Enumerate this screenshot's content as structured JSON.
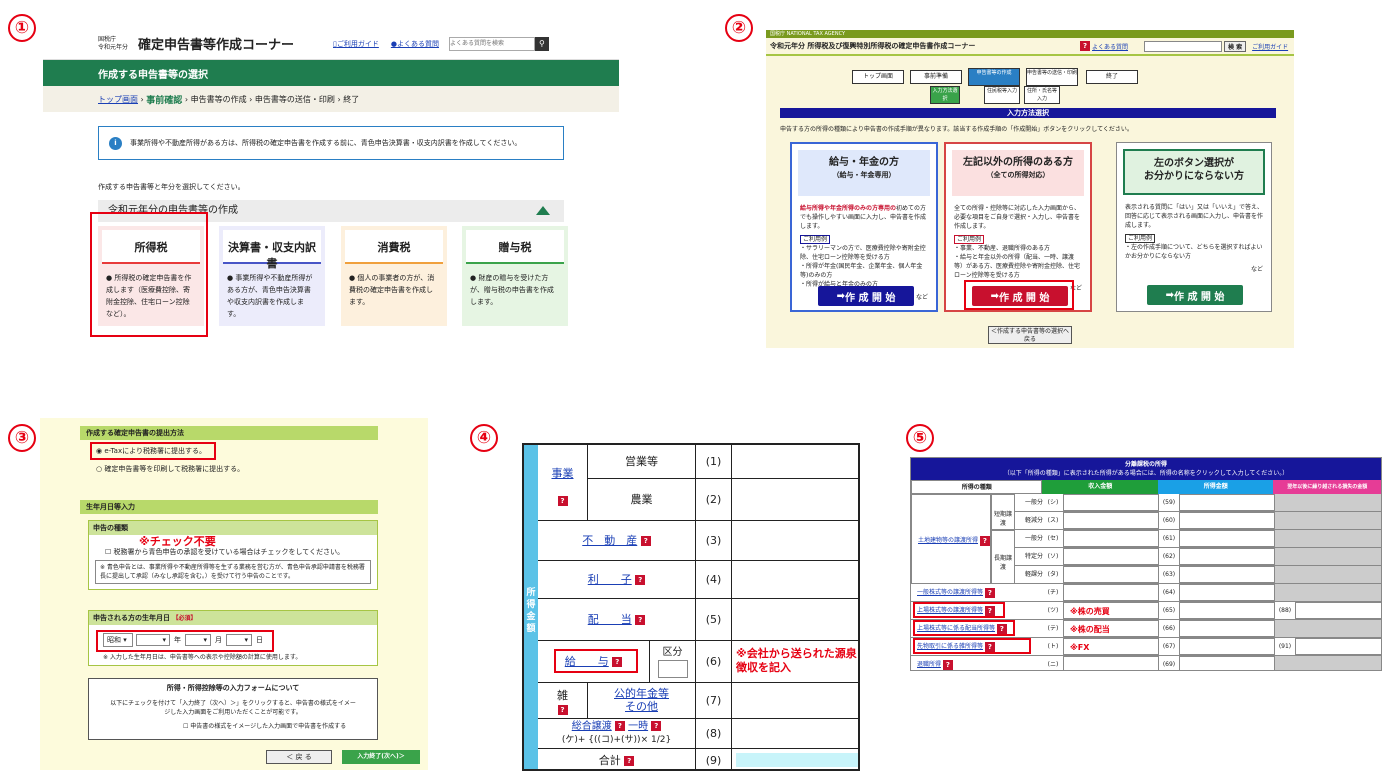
{
  "markers": [
    "①",
    "②",
    "③",
    "④",
    "⑤"
  ],
  "p1": {
    "agency": "国税庁",
    "year": "令和元年分",
    "title": "確定申告書等作成コーナー",
    "guide": "ご利用ガイド",
    "faq": "よくある質問",
    "search_placeholder": "よくある質問を検索",
    "banner": "作成する申告書等の選択",
    "crumbs": [
      "トップ画面",
      "事前確認",
      "申告書等の作成",
      "申告書等の送信・印刷",
      "終了"
    ],
    "info": "事業所得や不動産所得がある方は、所得税の確定申告書を作成する前に、青色申告決算書・収支内訳書を作成してください。",
    "instruction": "作成する申告書等と年分を選択してください。",
    "section": "令和元年分の申告書等の作成",
    "cards": [
      {
        "title": "所得税",
        "desc": "● 所得税の確定申告書を作成します（医療費控除、寄附金控除、住宅ローン控除など）。",
        "color": "#e83a3a",
        "bg": "#fbe7e7"
      },
      {
        "title": "決算書・収支内訳書",
        "desc": "● 事業所得や不動産所得がある方が、青色申告決算書や収支内訳書を作成します。",
        "color": "#4855c7",
        "bg": "#ececfb"
      },
      {
        "title": "消費税",
        "desc": "● 個人の事業者の方が、消費税の確定申告書を作成します。",
        "color": "#f0a03c",
        "bg": "#fdf0dd"
      },
      {
        "title": "贈与税",
        "desc": "● 財産の贈与を受けた方が、贈与税の申告書を作成します。",
        "color": "#3aa34a",
        "bg": "#e6f5e3"
      }
    ]
  },
  "p2": {
    "agency": "国税庁 NATIONAL TAX AGENCY",
    "title": "令和元年分 所得税及び復興特別所得税の確定申告書作成コーナー",
    "faq": "よくある質問",
    "search_btn": "検 索",
    "guide": "ご利用ガイド",
    "steps": [
      "トップ画面",
      "事前準備",
      "申告書等の作成",
      "申告書等の送信・印刷",
      "終了"
    ],
    "substeps": [
      "入力方法選択",
      "住民税等入力",
      "住所・氏名等入力"
    ],
    "section": "入力方法選択",
    "instruction": "申告する方の所得の種類により申告書の作成手順が異なります。該当する作成手順の「作成開始」ボタンをクリックしてください。",
    "boxes": [
      {
        "head": "給与・年金の方",
        "sub": "（給与・年金専用）",
        "lead": "給与所得や年金所得のみの方専用の",
        "body": "初めての方でも操作しやすい画面に入力し、申告書を作成します。",
        "usage": "ご利用例",
        "examples": "・サラリーマンの方で、医療費控除や寄附金控除、住宅ローン控除等を受ける方\n・所得が年金(国民年金、企業年金、個人年金等)のみの方\n・所得が給与と年金のみの方",
        "etc": "など",
        "btn": "作 成 開 始"
      },
      {
        "head": "左記以外の所得のある方",
        "sub": "（全ての所得対応）",
        "lead": "",
        "body": "全ての所得・控除等に対応した入力画面から、必要な項目をご自身で選択・入力し、申告書を作成します。",
        "usage": "ご利用例",
        "examples": "・事業、不動産、退職所得のある方\n・給与と年金以外の所得（配当、一時、譲渡等）がある方、医療費控除や寄附金控除、住宅ローン控除等を受ける方",
        "etc": "など",
        "btn": "作 成 開 始"
      },
      {
        "head": "左のボタン選択が",
        "sub": "お分かりにならない方",
        "lead": "",
        "body": "表示される質問に「はい」又は「いいえ」で答え、回答に応じて表示される画面に入力し、申告書を作成します。",
        "usage": "ご利用例",
        "examples": "・左の作成手順について、どちらを選択すればよいかお分かりにならない方",
        "etc": "など",
        "btn": "作 成 開 始"
      }
    ],
    "back": "＜作成する申告書等の選択へ戻る"
  },
  "p3": {
    "method_title": "作成する確定申告書の提出方法",
    "opt1": "e-Taxにより税務署に提出する。",
    "opt2": "確定申告書等を印刷して税務署に提出する。",
    "birth_section": "生年月日等入力",
    "kind_title": "申告の種類",
    "no_check": "※チェック不要",
    "kind_check": "税務署から青色申告の承認を受けている場合はチェックをしてください。",
    "note": "※ 青色申告とは、事業所得や不動産所得等を生ずる業務を営む方が、青色申告承認申請書を税務署長に提出して承認（みなし承認を含む。）を受けて行う申告のことです。",
    "birth_title": "申告される方の生年月日",
    "required": "必須",
    "era": "昭和",
    "y": "年",
    "m": "月",
    "d": "日",
    "birth_note": "※ 入力した生年月日は、申告書等への表示や控除額の計算に使用します。",
    "form_title": "所得・所得控除等の入力フォームについて",
    "form_text": "以下にチェックを付けて「入力終了（次へ）＞」をクリックすると、申告書の様式をイメージした入力画面をご利用いただくことが可能です。",
    "form_check": "申告書の様式をイメージした入力画面で申告書を作成する",
    "back": "＜ 戻 る",
    "next": "入力終了(次へ)＞"
  },
  "p4": {
    "side": "所得金額",
    "rows": [
      {
        "label": "事業",
        "sub": "営業等",
        "n": "(1)"
      },
      {
        "label": "",
        "sub": "農業",
        "n": "(2)"
      },
      {
        "label": "不　動　産",
        "n": "(3)"
      },
      {
        "label": "利　　子",
        "n": "(4)"
      },
      {
        "label": "配　　当",
        "n": "(5)"
      },
      {
        "label": "給　　与",
        "kubun": "区分",
        "n": "(6)"
      },
      {
        "label": "雑",
        "sub": "公的年金等\nその他",
        "n": "(7)"
      },
      {
        "label": "総合譲渡",
        "label2": "一時",
        "formula": "(ケ)+ {((コ)+(サ))× 1/2}",
        "n": "(8)"
      },
      {
        "label": "合計",
        "n": "(9)"
      }
    ],
    "note": "※会社から送られた源泉徴収を記入"
  },
  "p5": {
    "title": "分離課税の所得",
    "subtitle": "（以下「所得の種類」に表示された所得がある場合には、所得の名称をクリックして入力してください。）",
    "headers": [
      "所得の種類",
      "収入金額",
      "所得金額",
      "翌年以後に繰り越される損失の金額"
    ],
    "land": "土地建物等の譲渡所得",
    "short": "短期譲渡",
    "long": "長期譲渡",
    "rows": [
      {
        "k": "一般分",
        "c": "(シ)",
        "n": "(59)"
      },
      {
        "k": "軽減分",
        "c": "(ス)",
        "n": "(60)"
      },
      {
        "k": "一般分",
        "c": "(セ)",
        "n": "(61)"
      },
      {
        "k": "特定分",
        "c": "(ソ)",
        "n": "(62)"
      },
      {
        "k": "軽課分",
        "c": "(タ)",
        "n": "(63)"
      }
    ],
    "others": [
      {
        "name": "一般株式等の譲渡所得等",
        "c": "(チ)",
        "n": "(64)",
        "x": ""
      },
      {
        "name": "上場株式等の譲渡所得等",
        "c": "(ツ)",
        "n": "(65)",
        "x": "(88)",
        "note": "※株の売買"
      },
      {
        "name": "上場株式等に係る配当所得等",
        "c": "(テ)",
        "n": "(66)",
        "x": "",
        "note": "※株の配当"
      },
      {
        "name": "先物取引に係る雑所得等",
        "c": "(ト)",
        "n": "(67)",
        "x": "(91)",
        "note": "※FX"
      },
      {
        "name": "退職所得",
        "c": "(ニ)",
        "n": "(69)",
        "x": ""
      }
    ]
  }
}
